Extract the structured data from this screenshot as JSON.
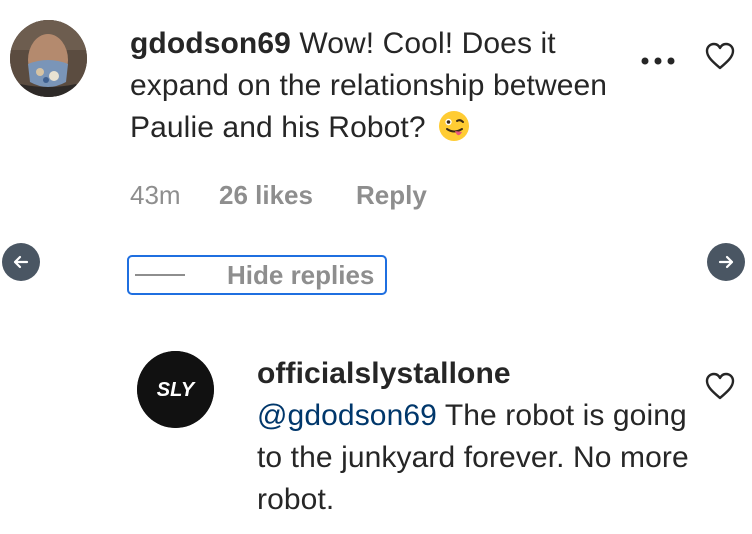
{
  "comment": {
    "username": "gdodson69",
    "text": "Wow! Cool! Does it expand on the relationship between Paulie and his Robot?",
    "emoji": "winking-face-with-tongue",
    "time": "43m",
    "likes": "26 likes",
    "reply_label": "Reply"
  },
  "replies_toggle": {
    "label": "Hide replies"
  },
  "reply": {
    "username": "officialslystallone",
    "avatar_text": "SLY",
    "mention": "@gdodson69",
    "text": "The robot is going to the junkyard forever. No more robot."
  },
  "icons": {
    "more": "more-horizontal-icon",
    "like": "heart-outline-icon",
    "prev": "arrow-left-icon",
    "next": "arrow-right-icon"
  },
  "colors": {
    "text": "#262626",
    "muted": "#8e8e8e",
    "mention": "#00376b",
    "focus_outline": "#1f6fe0",
    "nav_button": "#4a5663"
  }
}
